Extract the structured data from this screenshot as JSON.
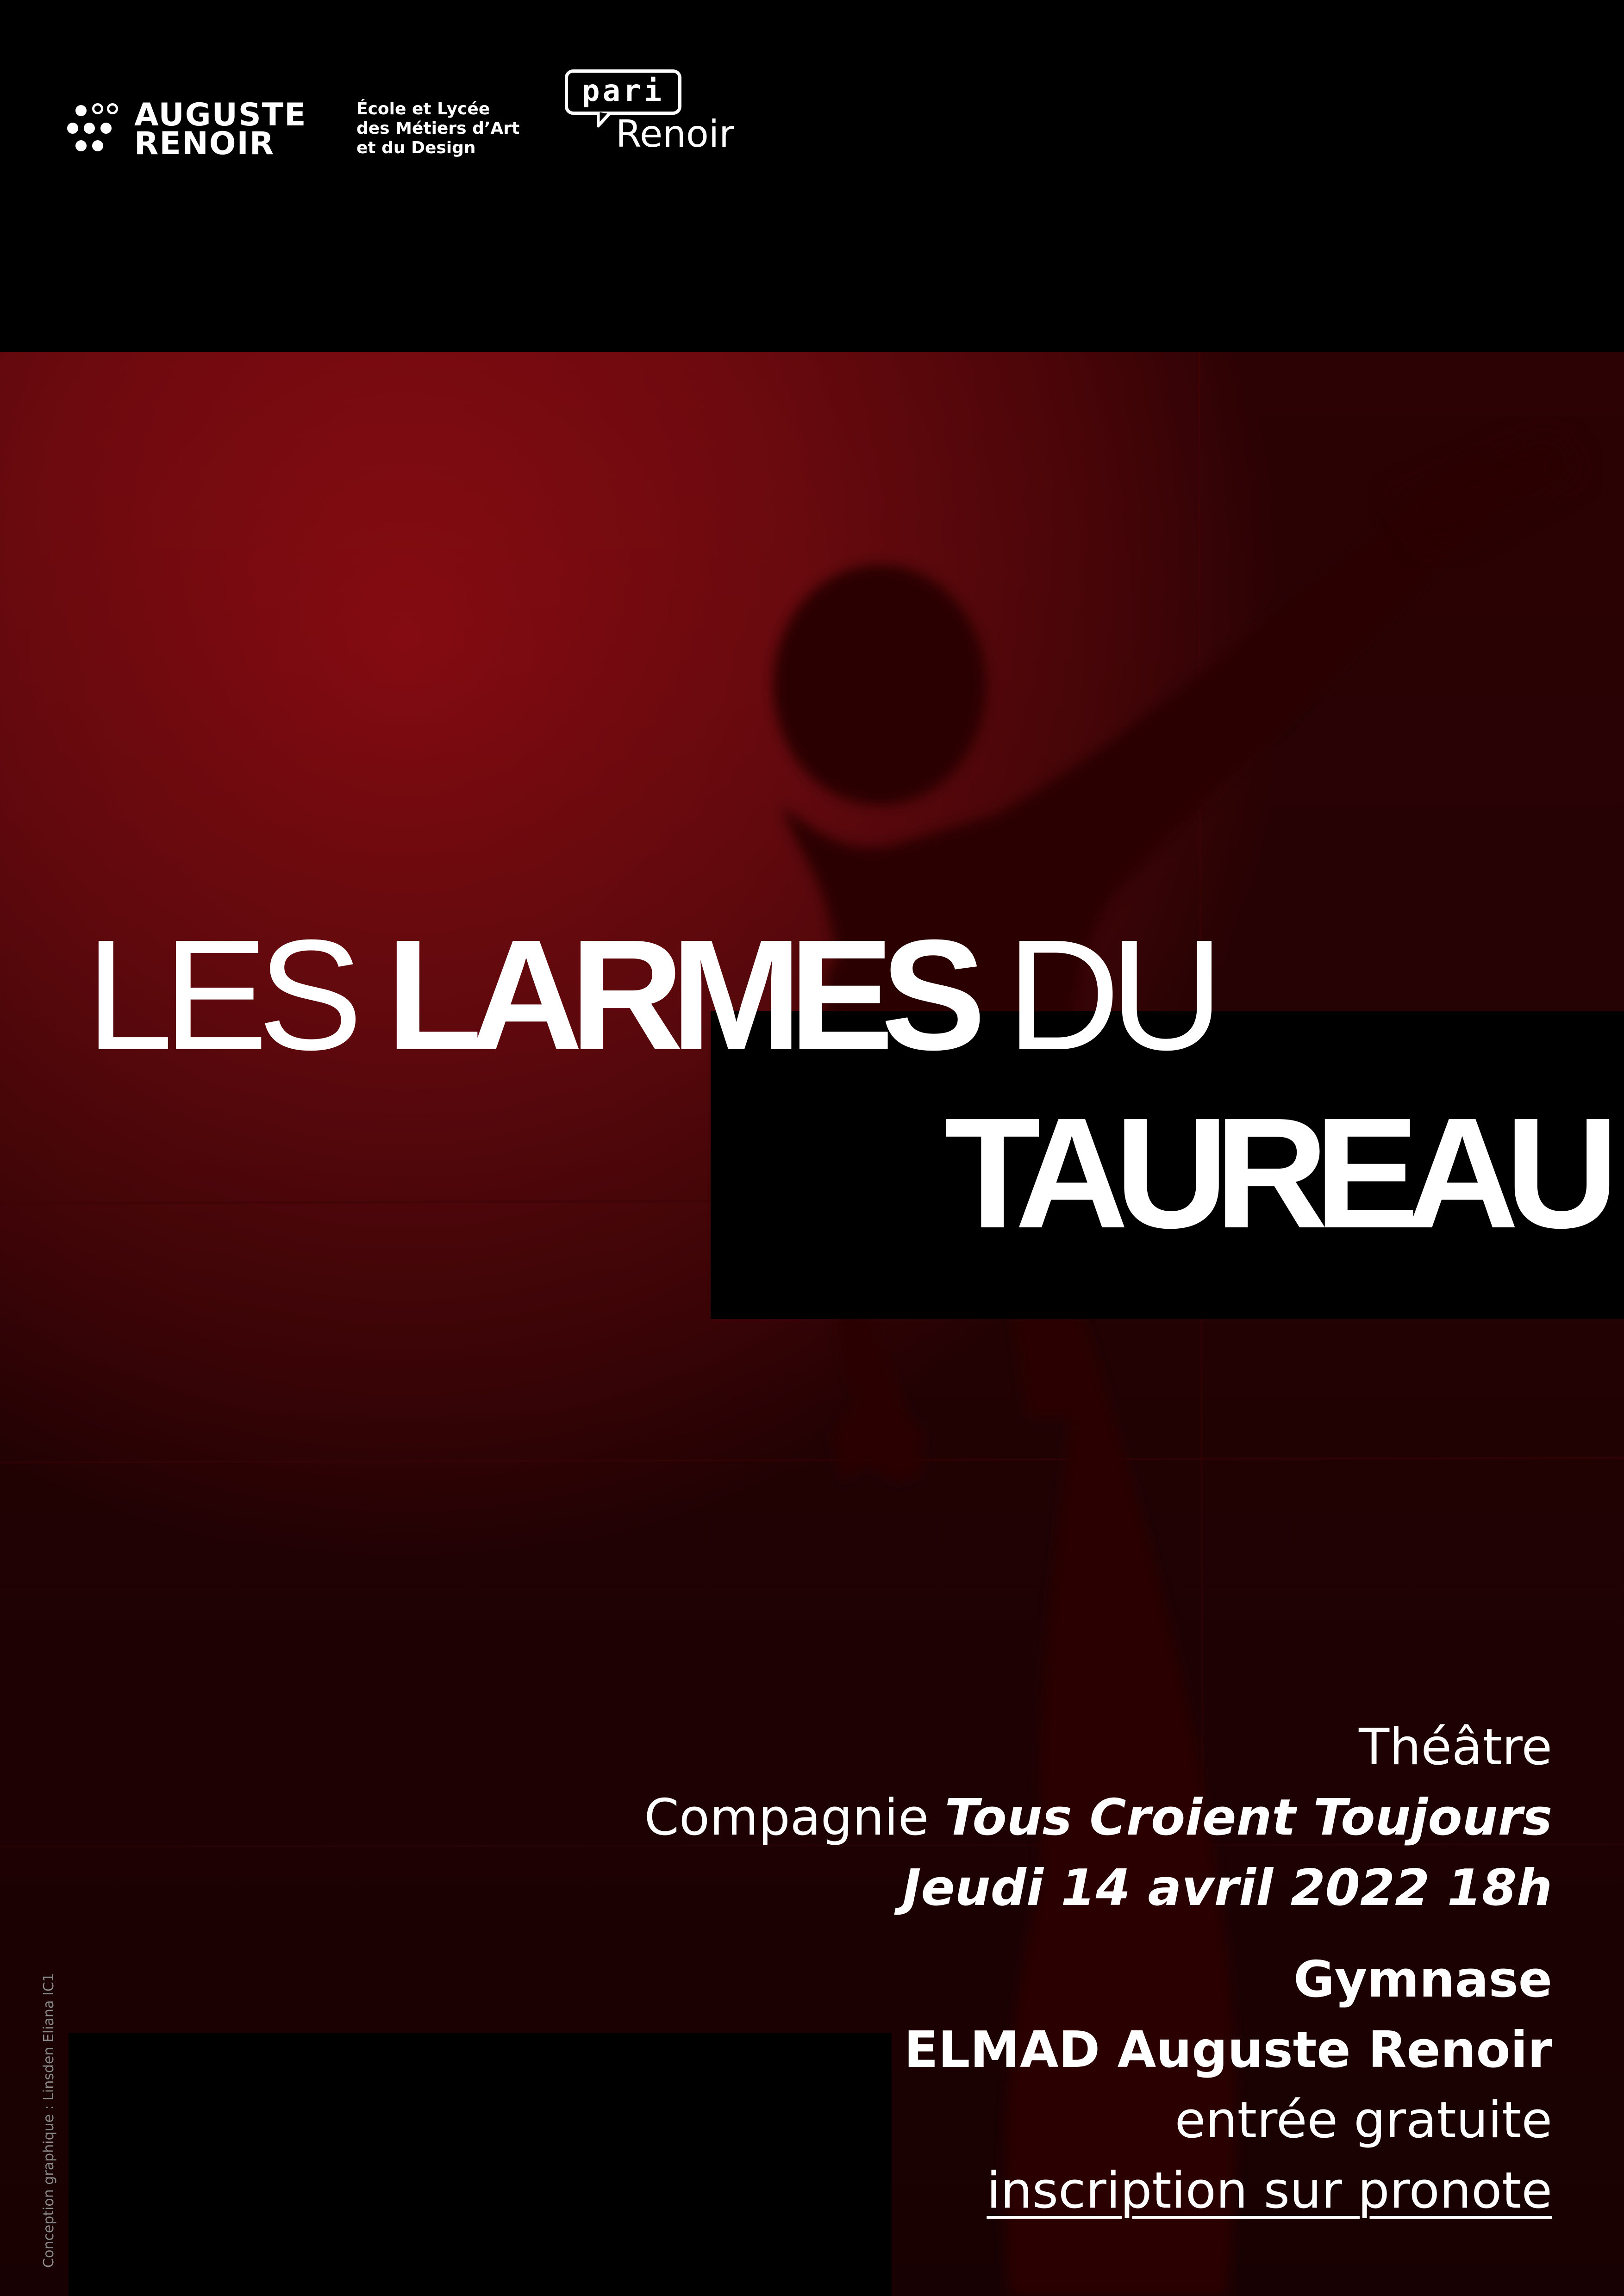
{
  "header": {
    "brand": {
      "line1": "AUGUSTE",
      "line2": "RENOIR",
      "subtitle": [
        "École et Lycée",
        "des Métiers d’Art",
        "et du Design"
      ]
    },
    "pari_logo": {
      "box_text": "pari",
      "word": "Renoir"
    }
  },
  "title": {
    "light_1": "LES",
    "bold_1": "LARMES",
    "light_2": "DU",
    "bold_2": "TAUREAU"
  },
  "info": {
    "genre": "Théâtre",
    "company_prefix": "Compagnie",
    "company_name": "Tous Croient Toujours",
    "date": "Jeudi 14 avril 2022 18h",
    "venue_line1": "Gymnase",
    "venue_line2": "ELMAD Auguste Renoir",
    "price": "entrée gratuite",
    "registration": "inscription sur pronote"
  },
  "credit": "Conception graphique : Linsden Eliana IC1",
  "colors": {
    "background_red": "#6e0a0f",
    "black": "#000000",
    "text": "#ffffff"
  }
}
